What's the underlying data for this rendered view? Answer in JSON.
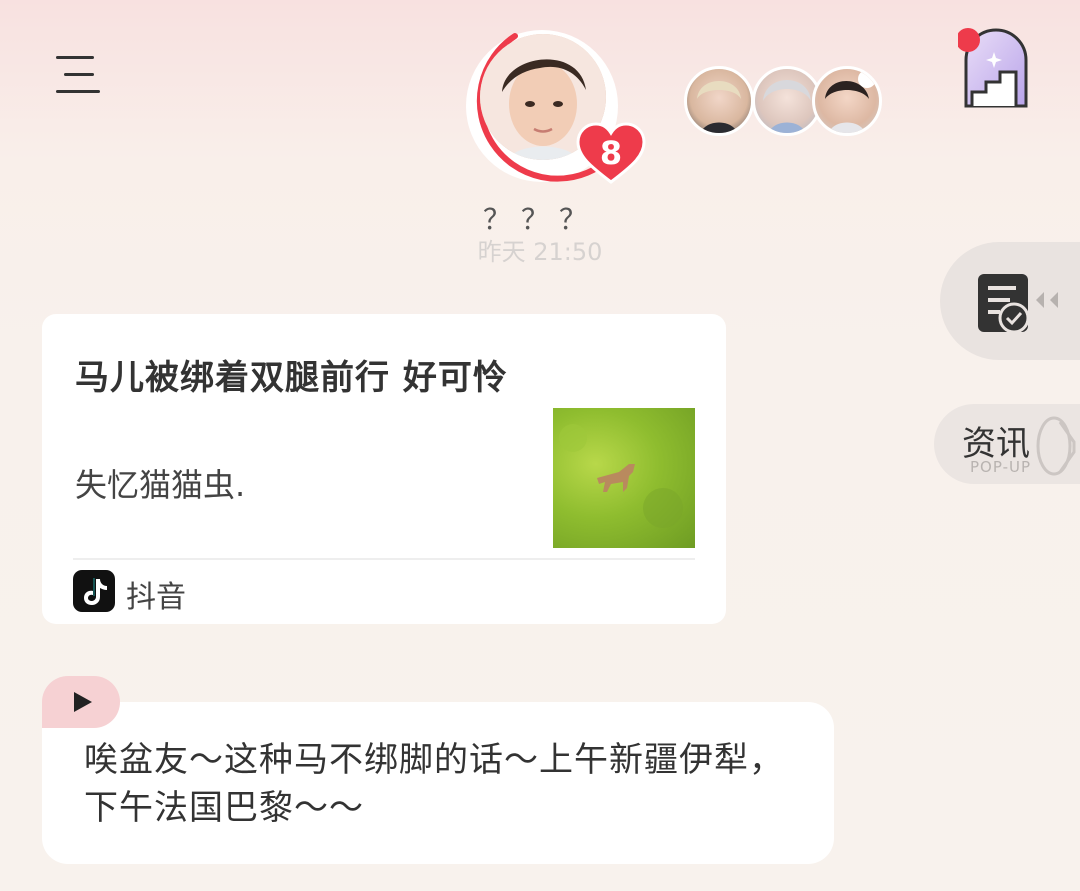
{
  "header": {
    "character_name": "？？？",
    "timestamp": "昨天 21:50",
    "heart_count": "8",
    "accent_color": "#ee3b4b"
  },
  "icons": {
    "menu": "menu-icon",
    "gallery": "staircase-arch-icon",
    "todo": "task-checklist-icon",
    "collapse": "double-chevron-left-icon"
  },
  "side": {
    "news_label": "资讯",
    "news_sub": "POP-UP"
  },
  "share_card": {
    "title": "马儿被绑着双腿前行 好可怜",
    "description": "失忆猫猫虫.",
    "source": "抖音"
  },
  "reply": {
    "text": "唉盆友～这种马不绑脚的话～上午新疆伊犁，下午法国巴黎～～"
  }
}
